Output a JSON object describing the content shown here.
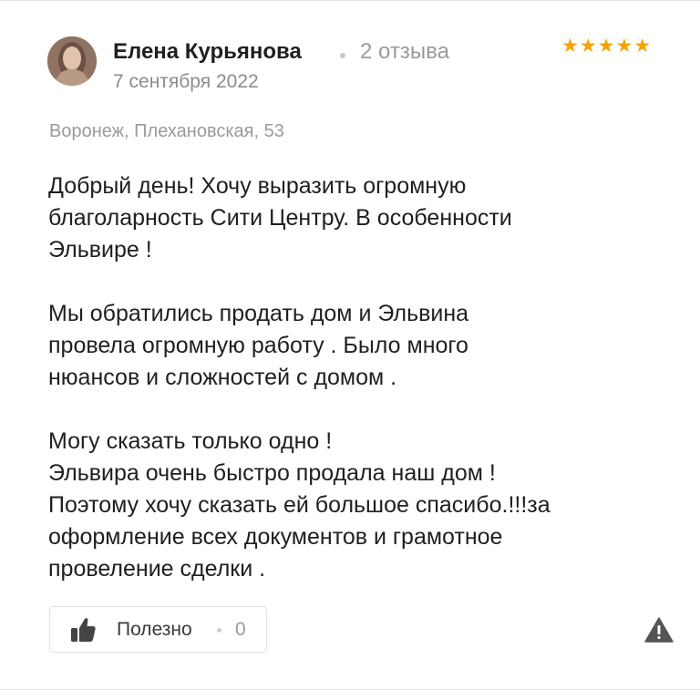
{
  "review": {
    "author_name": "Елена Курьянова",
    "reviews_count": "2 отзыва",
    "date": "7 сентября 2022",
    "rating": 5,
    "stars": [
      "★",
      "★",
      "★",
      "★",
      "★"
    ],
    "location": "Воронеж, Плехановская, 53",
    "paragraphs": [
      "Добрый день! Хочу выразить огромную\nблаголарность Сити Центру. В особенности\nЭльвире !",
      "Мы обратились продать дом и Эльвина\nпровела огромную работу . Было много\nнюансов и сложностей с домом .",
      "Могу сказать только одно !\nЭльвира очень быстро продала наш дом !\nПоэтому хочу сказать ей большое спасибо.!!!за\nоформление всех документов и грамотное\nпровеление сделки ."
    ]
  },
  "actions": {
    "helpful_label": "Полезно",
    "helpful_count": "0"
  },
  "icons": {
    "avatar": "avatar-photo",
    "thumb": "thumbs-up-icon",
    "report": "warning-icon"
  },
  "colors": {
    "star": "#f6a200",
    "muted_text": "#9a9a9a",
    "main_text": "#1f1f1f"
  }
}
